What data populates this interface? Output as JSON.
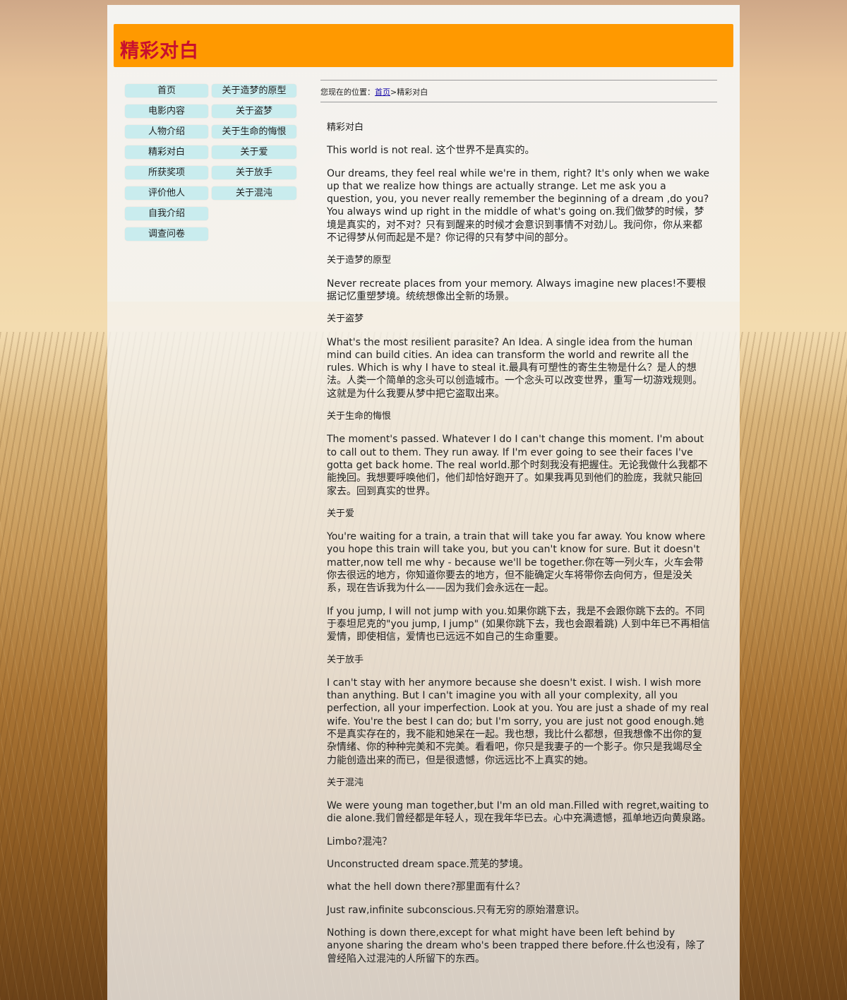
{
  "header": {
    "title": "精彩对白"
  },
  "nav": {
    "col1": [
      {
        "label": "首页",
        "name": "nav-home"
      },
      {
        "label": "电影内容",
        "name": "nav-movie-content"
      },
      {
        "label": "人物介绍",
        "name": "nav-characters"
      },
      {
        "label": "精彩对白",
        "name": "nav-dialogues"
      },
      {
        "label": "所获奖项",
        "name": "nav-awards"
      },
      {
        "label": "评价他人",
        "name": "nav-reviews"
      },
      {
        "label": "自我介绍",
        "name": "nav-self-intro"
      },
      {
        "label": "调查问卷",
        "name": "nav-survey"
      }
    ],
    "col2": [
      {
        "label": "关于造梦的原型",
        "name": "nav-dream-prototype"
      },
      {
        "label": "关于盗梦",
        "name": "nav-dream-theft"
      },
      {
        "label": "关于生命的悔恨",
        "name": "nav-life-regret"
      },
      {
        "label": "关于爱",
        "name": "nav-love"
      },
      {
        "label": "关于放手",
        "name": "nav-letting-go"
      },
      {
        "label": "关于混沌",
        "name": "nav-limbo"
      }
    ]
  },
  "breadcrumb": {
    "prefix": "您现在的位置：",
    "home_link": "首页",
    "separator": ">",
    "current": "精彩对白"
  },
  "content": {
    "paragraphs": [
      {
        "text": "精彩对白",
        "heading": true
      },
      {
        "text": "This world is not real. 这个世界不是真实的。"
      },
      {
        "text": "Our dreams, they feel real while we're in them, right? It's only when we wake up that we realize how things are actually strange. Let me ask you a question, you, you never really remember the beginning of a dream ,do you? You always wind up right in the middle of what's going on.我们做梦的时候，梦境是真实的，对不对？只有到醒来的时候才会意识到事情不对劲儿。我问你，你从来都不记得梦从何而起是不是？你记得的只有梦中间的部分。"
      },
      {
        "text": "关于造梦的原型",
        "heading": true
      },
      {
        "text": "Never recreate places from your memory. Always imagine new places!不要根据记忆重塑梦境。统统想像出全新的场景。"
      },
      {
        "text": "关于盗梦",
        "heading": true
      },
      {
        "text": "What's the most resilient parasite? An Idea. A single idea from the human mind can build cities. An idea can transform the world and rewrite all the rules. Which is why I have to steal it.最具有可塑性的寄生生物是什么？是人的想法。人类一个简单的念头可以创造城市。一个念头可以改变世界，重写一切游戏规则。这就是为什么我要从梦中把它盗取出来。"
      },
      {
        "text": "关于生命的悔恨",
        "heading": true
      },
      {
        "text": "The moment's passed. Whatever I do I can't change this moment. I'm about to call out to them. They run away. If I'm ever going to see their faces I've gotta get back home. The real world.那个时刻我没有把握住。无论我做什么我都不能挽回。我想要呼唤他们，他们却恰好跑开了。如果我再见到他们的脸庞，我就只能回家去。回到真实的世界。"
      },
      {
        "text": "关于爱",
        "heading": true
      },
      {
        "text": "You're waiting for a train, a train that will take you far away. You know where you hope this train will take you, but you can't know for sure. But it doesn't matter,now tell me why - because we'll be together.你在等一列火车，火车会带你去很远的地方，你知道你要去的地方，但不能确定火车将带你去向何方，但是没关系，现在告诉我为什么——因为我们会永远在一起。"
      },
      {
        "text": "If you jump, I will not jump with you.如果你跳下去，我是不会跟你跳下去的。不同于泰坦尼克的\"you jump, I jump\" (如果你跳下去，我也会跟着跳) 人到中年已不再相信爱情，即使相信，爱情也已远远不如自己的生命重要。"
      },
      {
        "text": "关于放手",
        "heading": true
      },
      {
        "text": "I can't stay with her anymore because she doesn't exist. I wish. I wish more than anything. But I can't imagine you with all your complexity, all you perfection, all your imperfection. Look at you. You are just a shade of my real wife. You're the best I can do; but I'm sorry, you are just not good enough.她不是真实存在的，我不能和她呆在一起。我也想，我比什么都想，但我想像不出你的复杂情绪、你的种种完美和不完美。看看吧，你只是我妻子的一个影子。你只是我竭尽全力能创造出来的而已，但是很遗憾，你远远比不上真实的她。"
      },
      {
        "text": "关于混沌",
        "heading": true
      },
      {
        "text": "We were young man together,but I'm an old man.Filled with regret,waiting to die alone.我们曾经都是年轻人，现在我年华已去。心中充满遗憾，孤单地迈向黄泉路。"
      },
      {
        "text": "Limbo?混沌？"
      },
      {
        "text": "Unconstructed dream space.荒芜的梦境。"
      },
      {
        "text": "what the hell down there?那里面有什么？"
      },
      {
        "text": "Just raw,infinite subconscious.只有无穷的原始潜意识。"
      },
      {
        "text": "Nothing is down there,except for what might have been left behind by anyone sharing the dream who's been trapped there before.什么也没有，除了曾经陷入过混沌的人所留下的东西。"
      }
    ]
  }
}
